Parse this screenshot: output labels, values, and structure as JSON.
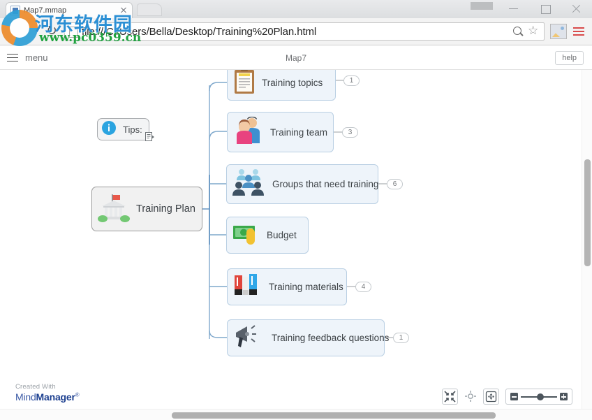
{
  "browser": {
    "tab": {
      "title": "Map7.mmap",
      "favicon": "mindmanager-file-icon",
      "close": "close-icon"
    },
    "newtab_label": "",
    "url": "file:///C:/Users/Bella/Desktop/Training%20Plan.html",
    "reload_glyph": "↻",
    "icons": {
      "zoom_out": "zoom-out-icon",
      "bookmark": "☆",
      "extension": "image-extension-icon",
      "menu": "browser-menu-icon"
    },
    "window": {
      "minimize": "minimize-icon",
      "maximize": "maximize-icon",
      "close": "close-icon"
    }
  },
  "watermark": {
    "site_cn": "河东软件园",
    "site_url": "www.pc0359.cn"
  },
  "app": {
    "menu_label": "menu",
    "title": "Map7",
    "help_label": "help"
  },
  "map": {
    "central": {
      "label": "Training Plan",
      "icon": "government-building-icon"
    },
    "tips": {
      "label": "Tips:",
      "icon": "info-icon",
      "note_icon": "note-icon"
    },
    "topics": [
      {
        "label": "Training topics",
        "icon": "clipboard-icon",
        "badge": "1"
      },
      {
        "label": "Training team",
        "icon": "people-pair-icon",
        "badge": "3"
      },
      {
        "label": "Groups that need training",
        "icon": "group-icon",
        "badge": "6"
      },
      {
        "label": "Budget",
        "icon": "money-icon",
        "badge": ""
      },
      {
        "label": "Training materials",
        "icon": "binders-icon",
        "badge": "4"
      },
      {
        "label": "Training feedback questions",
        "icon": "megaphone-icon",
        "badge": "1"
      }
    ]
  },
  "brand": {
    "created_with": "Created With",
    "name_light": "Mind",
    "name_bold": "Manager",
    "registered": "®"
  },
  "controls": {
    "fit_label": "fit-to-page-button",
    "center_label": "center-map-button",
    "pan_label": "pan-mode-button",
    "zoom_minus": "−",
    "zoom_plus": "+",
    "zoom_value": "44"
  },
  "colors": {
    "node_fill": "#eef4fa",
    "node_border": "#b9cfe3",
    "central_fill": "#f1f1f1",
    "connector": "#7fa8cc",
    "accent_blue": "#2b8fd4"
  }
}
